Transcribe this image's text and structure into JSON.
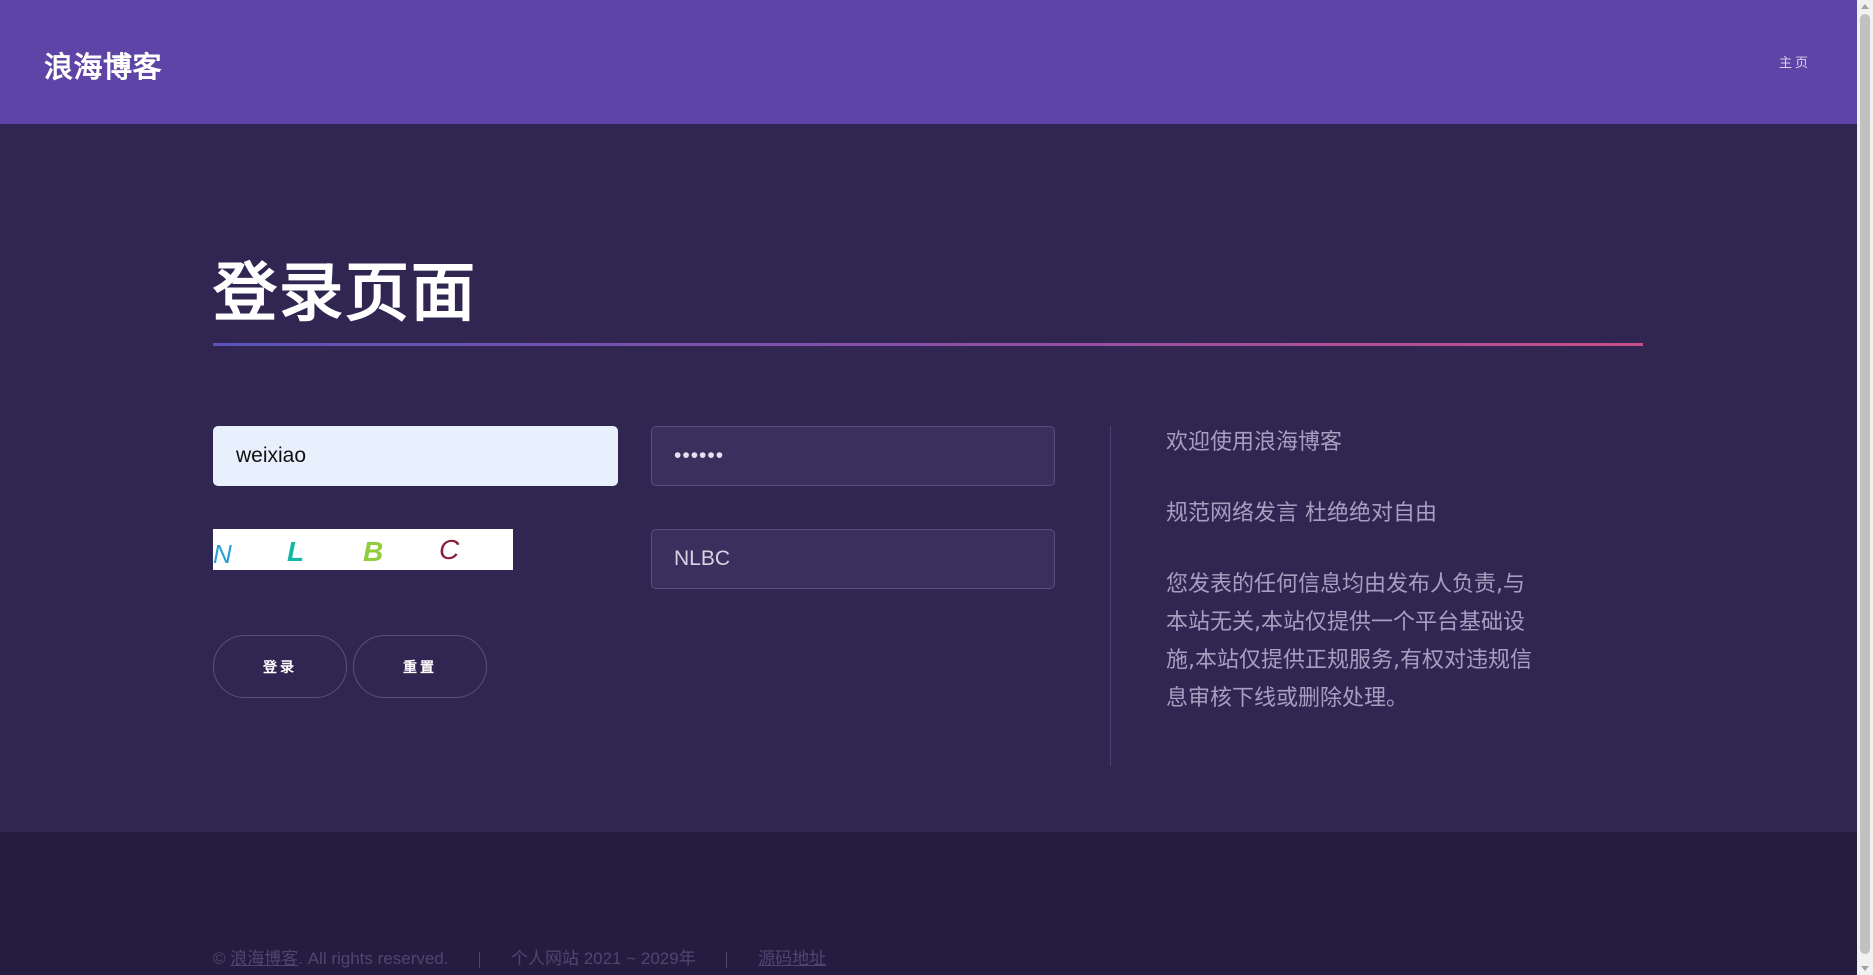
{
  "header": {
    "brand": "浪海博客",
    "nav_home": "主页"
  },
  "login": {
    "title": "登录页面",
    "username_value": "weixiao",
    "password_value": "••••••",
    "captcha_image_chars": [
      "N",
      "L",
      "B",
      "C"
    ],
    "captcha_input_value": "NLBC",
    "login_button": "登录",
    "reset_button": "重置"
  },
  "info": {
    "welcome": "欢迎使用浪海博客",
    "rule": "规范网络发言 杜绝绝对自由",
    "notice": "您发表的任何信息均由发布人负责,与本站无关,本站仅提供一个平台基础设施,本站仅提供正规服务,有权对违规信息审核下线或删除处理。"
  },
  "footer": {
    "copyright_prefix": "©",
    "copyright_link": "浪海博客",
    "copyright_suffix": ". All rights reserved.",
    "site_info": "个人网站 2021 ~ 2029年",
    "source_link": "源码地址"
  },
  "colors": {
    "header_bg": "#5e44a6",
    "main_bg": "#312552",
    "footer_bg": "#251d3f",
    "accent_gradient_start": "#5a54b8",
    "accent_gradient_end": "#c94f8a"
  }
}
